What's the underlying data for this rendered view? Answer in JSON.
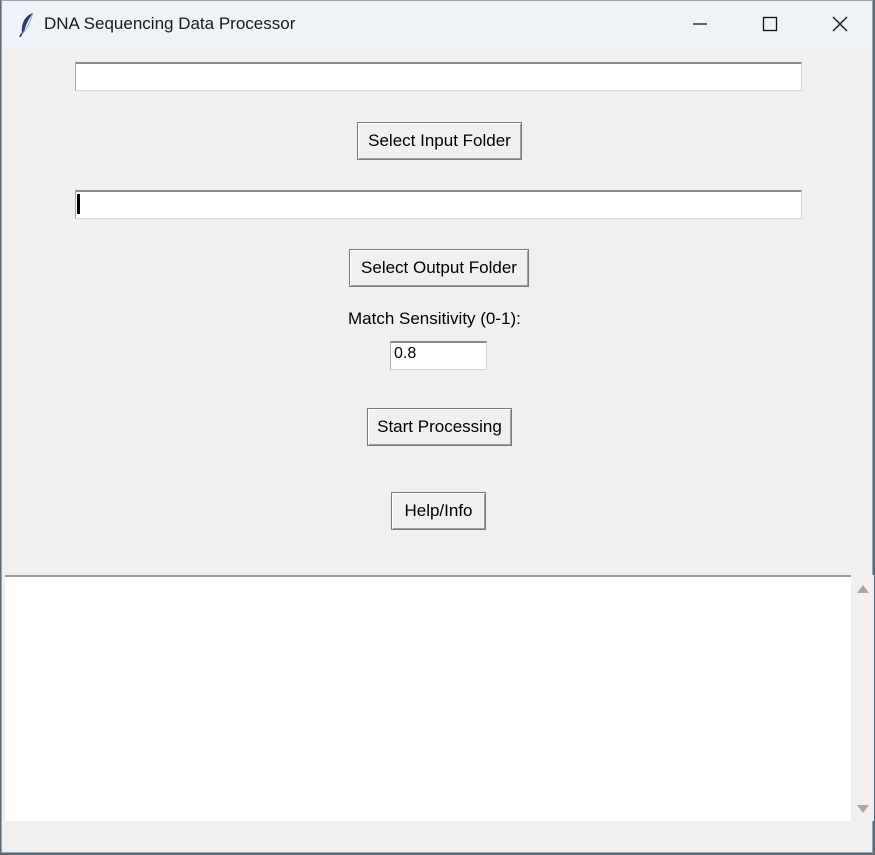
{
  "window": {
    "title": "DNA Sequencing Data Processor",
    "controls": [
      "minimize-icon",
      "maximize-icon",
      "close-icon"
    ]
  },
  "input_folder": {
    "value": ""
  },
  "select_input_button": {
    "label": "Select Input Folder"
  },
  "output_folder": {
    "value": ""
  },
  "select_output_button": {
    "label": "Select Output Folder"
  },
  "sensitivity": {
    "label": "Match Sensitivity (0-1):",
    "value": "0.8"
  },
  "start_button": {
    "label": "Start Processing"
  },
  "help_button": {
    "label": "Help/Info"
  },
  "log": {
    "text": ""
  },
  "icons": {
    "app": "feather-icon",
    "scroll_up": "scroll-up-arrow",
    "scroll_down": "scroll-down-arrow"
  }
}
